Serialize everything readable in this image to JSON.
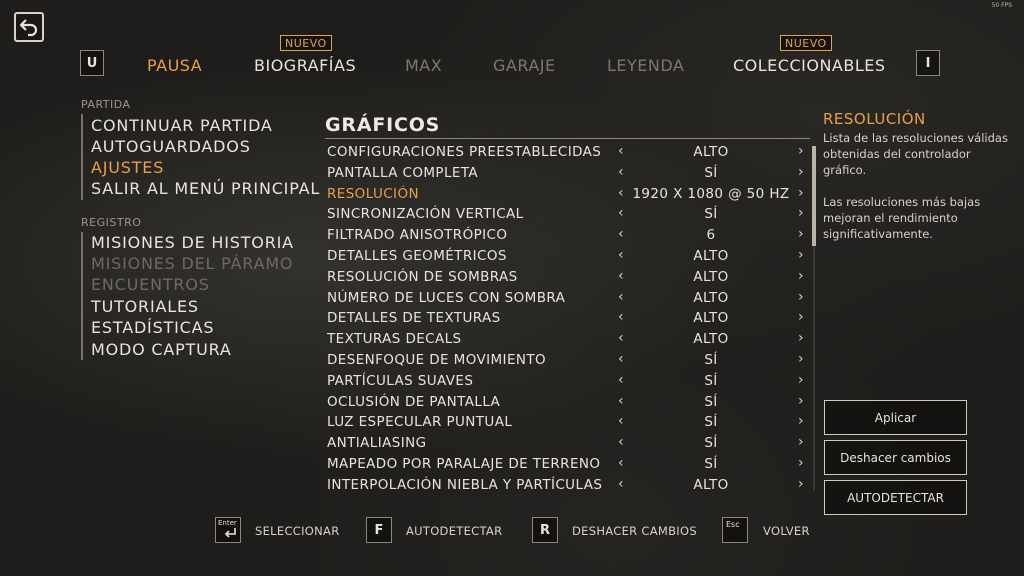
{
  "fps_counter": "50 FPS",
  "top_tabs": {
    "left_key": "U",
    "right_key": "I",
    "badge": "NUEVO",
    "items": [
      {
        "label": "PAUSA",
        "state": "active"
      },
      {
        "label": "BIOGRAFÍAS",
        "state": "normal",
        "badge": true
      },
      {
        "label": "MAX",
        "state": "disabled"
      },
      {
        "label": "GARAJE",
        "state": "disabled"
      },
      {
        "label": "LEYENDA",
        "state": "disabled"
      },
      {
        "label": "COLECCIONABLES",
        "state": "normal",
        "badge": true
      }
    ]
  },
  "left_menu": {
    "sections": [
      {
        "heading": "PARTIDA",
        "items": [
          {
            "label": "CONTINUAR PARTIDA",
            "state": "normal"
          },
          {
            "label": "AUTOGUARDADOS",
            "state": "normal"
          },
          {
            "label": "AJUSTES",
            "state": "active"
          },
          {
            "label": "SALIR AL MENÚ PRINCIPAL",
            "state": "normal"
          }
        ]
      },
      {
        "heading": "REGISTRO",
        "items": [
          {
            "label": "MISIONES DE HISTORIA",
            "state": "normal"
          },
          {
            "label": "MISIONES DEL PÁRAMO",
            "state": "disabled"
          },
          {
            "label": "ENCUENTROS",
            "state": "disabled"
          },
          {
            "label": "TUTORIALES",
            "state": "normal"
          },
          {
            "label": "ESTADÍSTICAS",
            "state": "normal"
          },
          {
            "label": "MODO CAPTURA",
            "state": "normal"
          }
        ]
      }
    ]
  },
  "settings": {
    "title": "GRÁFICOS",
    "arrow_left": "‹",
    "arrow_right": "›",
    "rows": [
      {
        "label": "CONFIGURACIONES PREESTABLECIDAS",
        "value": "ALTO"
      },
      {
        "label": "PANTALLA COMPLETA",
        "value": "SÍ"
      },
      {
        "label": "RESOLUCIÓN",
        "value": "1920 X 1080 @ 50 HZ",
        "selected": true
      },
      {
        "label": "SINCRONIZACIÓN VERTICAL",
        "value": "SÍ"
      },
      {
        "label": "FILTRADO ANISOTRÓPICO",
        "value": "6"
      },
      {
        "label": "DETALLES GEOMÉTRICOS",
        "value": "ALTO"
      },
      {
        "label": "RESOLUCIÓN DE SOMBRAS",
        "value": "ALTO"
      },
      {
        "label": "NÚMERO DE LUCES CON SOMBRA",
        "value": "ALTO"
      },
      {
        "label": "DETALLES DE TEXTURAS",
        "value": "ALTO"
      },
      {
        "label": "TEXTURAS DECALS",
        "value": "ALTO"
      },
      {
        "label": "DESENFOQUE DE MOVIMIENTO",
        "value": "SÍ"
      },
      {
        "label": "PARTÍCULAS SUAVES",
        "value": "SÍ"
      },
      {
        "label": "OCLUSIÓN DE PANTALLA",
        "value": "SÍ"
      },
      {
        "label": "LUZ ESPECULAR PUNTUAL",
        "value": "SÍ"
      },
      {
        "label": "ANTIALIASING",
        "value": "SÍ"
      },
      {
        "label": "MAPEADO POR PARALAJE DE TERRENO",
        "value": "SÍ"
      },
      {
        "label": "INTERPOLACIÓN NIEBLA Y PARTÍCULAS",
        "value": "ALTO"
      }
    ]
  },
  "help_panel": {
    "title": "RESOLUCIÓN",
    "paragraph1": "Lista de las resoluciones válidas obtenidas del controlador gráfico.",
    "paragraph2": "Las resoluciones más bajas mejoran el rendimiento significativamente."
  },
  "buttons": {
    "apply": "Aplicar",
    "undo": "Deshacer cambios",
    "autodetect": "AUTODETECTAR"
  },
  "hints": [
    {
      "key": "Enter",
      "label": "SELECCIONAR"
    },
    {
      "key": "F",
      "label": "AUTODETECTAR"
    },
    {
      "key": "R",
      "label": "DESHACER CAMBIOS"
    },
    {
      "key": "Esc",
      "label": "VOLVER"
    }
  ],
  "colors": {
    "accent": "#e6a04a",
    "text": "#e9e4da",
    "disabled": "#7d786f",
    "background": "#1e1d1b"
  }
}
